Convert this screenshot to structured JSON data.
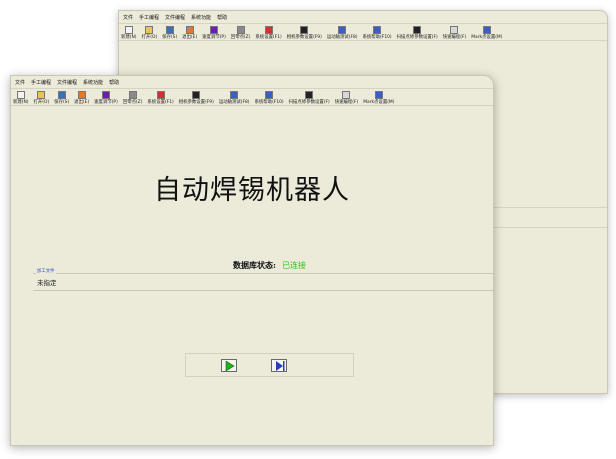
{
  "menu": [
    "文件",
    "手工编程",
    "文件编程",
    "系统功能",
    "帮助"
  ],
  "toolbar": [
    {
      "label": "新建(N)",
      "icon": "new-file-icon",
      "color": "#f2f2f2"
    },
    {
      "label": "打开(O)",
      "icon": "open-folder-icon",
      "color": "#e8c453"
    },
    {
      "label": "保存(S)",
      "icon": "save-disk-icon",
      "color": "#3a6fb6"
    },
    {
      "label": "退出(E)",
      "icon": "exit-icon",
      "color": "#e07a2a"
    },
    {
      "label": "速度调节(P)",
      "icon": "speed-dial-icon",
      "color": "#6a1fb0"
    },
    {
      "label": "回零点(Z)",
      "icon": "zoom-search-icon",
      "color": "#8a8a8a"
    },
    {
      "label": "系统设置(F1)",
      "icon": "settings-icon",
      "color": "#d43030"
    },
    {
      "label": "相机参数设置(F9)",
      "icon": "camera-icon",
      "color": "#222222"
    },
    {
      "label": "运动轴测试(F8)",
      "icon": "axis-test-icon",
      "color": "#3a5ec4"
    },
    {
      "label": "系统帮助(F10)",
      "icon": "help-icon",
      "color": "#3a5ec4"
    },
    {
      "label": "扫描点修参数设置(F)",
      "icon": "scan-icon",
      "color": "#222222"
    },
    {
      "label": "快速编程(F)",
      "icon": "quick-program-icon",
      "color": "#d8d8d8"
    },
    {
      "label": "Mark点设置(M)",
      "icon": "mark-point-icon",
      "color": "#3a5ec4"
    }
  ],
  "main": {
    "title": "自动焊锡机器人",
    "db_status_label": "数据库状态:",
    "db_status_value": "已连接",
    "file_group_label": "加工文件",
    "file_value": "未指定"
  },
  "colors": {
    "window_bg": "#ecead9",
    "status_ok": "#29c41f",
    "legend_blue": "#2a58c6",
    "start_arrow": "#1fb21f",
    "next_arrow": "#2a3fb8"
  },
  "controls": {
    "start": {
      "icon": "play-icon"
    },
    "next": {
      "icon": "step-next-icon"
    }
  }
}
